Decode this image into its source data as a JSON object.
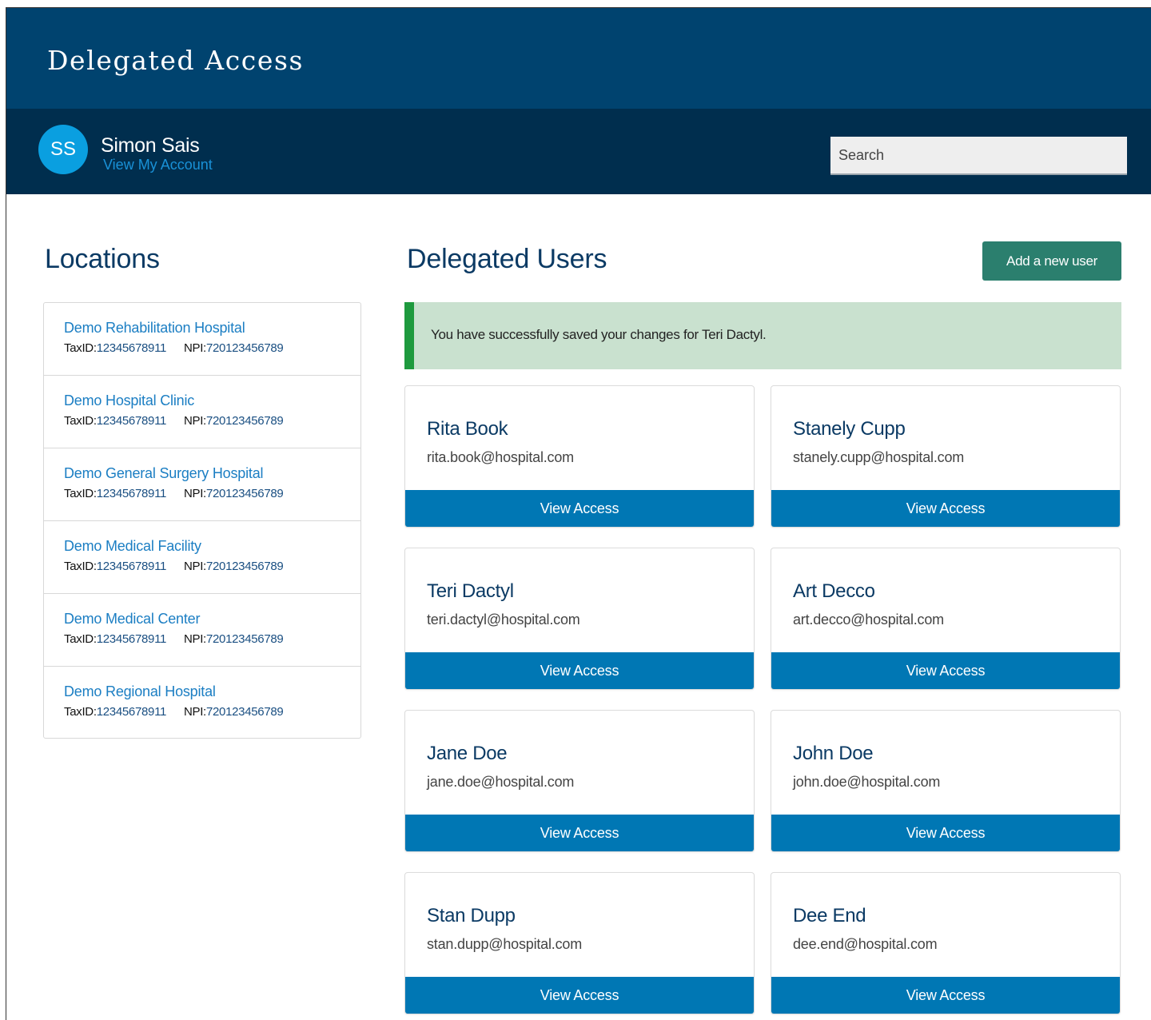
{
  "app": {
    "title": "Delegated Access"
  },
  "user": {
    "initials": "SS",
    "name": "Simon Sais",
    "account_link": "View My Account"
  },
  "search": {
    "placeholder": "Search"
  },
  "locations_section": {
    "title": "Locations",
    "items": [
      {
        "name": "Demo Rehabilitation Hospital",
        "tax_label": "TaxID:",
        "tax_id": "12345678911",
        "npi_label": "NPI:",
        "npi": "720123456789"
      },
      {
        "name": "Demo Hospital Clinic",
        "tax_label": "TaxID:",
        "tax_id": "12345678911",
        "npi_label": "NPI:",
        "npi": "720123456789"
      },
      {
        "name": "Demo General Surgery Hospital",
        "tax_label": "TaxID:",
        "tax_id": "12345678911",
        "npi_label": "NPI:",
        "npi": "720123456789"
      },
      {
        "name": "Demo Medical Facility",
        "tax_label": "TaxID:",
        "tax_id": "12345678911",
        "npi_label": "NPI:",
        "npi": "720123456789"
      },
      {
        "name": "Demo Medical Center",
        "tax_label": "TaxID:",
        "tax_id": "12345678911",
        "npi_label": "NPI:",
        "npi": "720123456789"
      },
      {
        "name": "Demo Regional Hospital",
        "tax_label": "TaxID:",
        "tax_id": "12345678911",
        "npi_label": "NPI:",
        "npi": "720123456789"
      }
    ]
  },
  "users_section": {
    "title": "Delegated Users",
    "add_button": "Add a new user",
    "alert": "You have successfully saved your changes for Teri Dactyl.",
    "view_access_label": "View Access",
    "users": [
      {
        "name": "Rita Book",
        "email": "rita.book@hospital.com"
      },
      {
        "name": "Stanely Cupp",
        "email": "stanely.cupp@hospital.com"
      },
      {
        "name": "Teri Dactyl",
        "email": "teri.dactyl@hospital.com"
      },
      {
        "name": "Art Decco",
        "email": "art.decco@hospital.com"
      },
      {
        "name": "Jane Doe",
        "email": "jane.doe@hospital.com"
      },
      {
        "name": "John Doe",
        "email": "john.doe@hospital.com"
      },
      {
        "name": "Stan Dupp",
        "email": "stan.dupp@hospital.com"
      },
      {
        "name": "Dee End",
        "email": "dee.end@hospital.com"
      }
    ]
  },
  "colors": {
    "header": "#00436f",
    "user_bar": "#002e4e",
    "avatar": "#0a9fe0",
    "primary_button": "#0077b4",
    "add_button": "#2b7f6e",
    "alert_bg": "#c9e1cf",
    "alert_border": "#1e9a3e"
  }
}
